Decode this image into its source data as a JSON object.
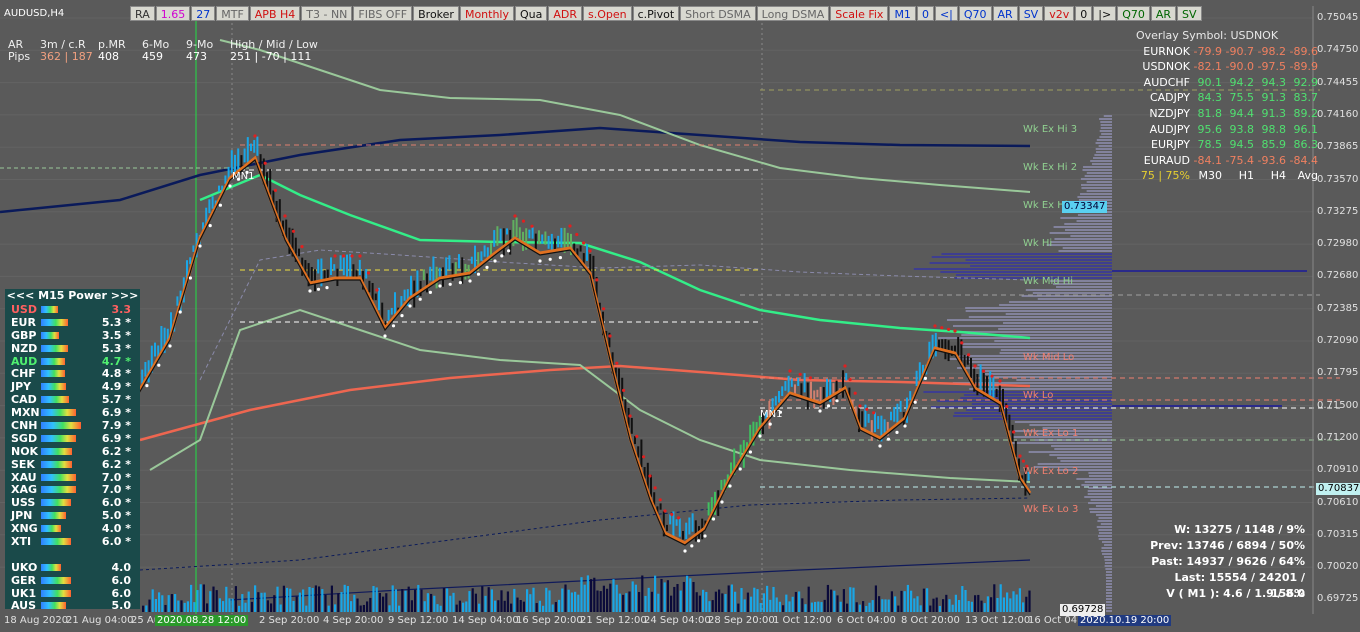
{
  "window": {
    "symbol_label": "AUDUSD,H4"
  },
  "toolbar": [
    {
      "label": "RA",
      "color": "#333"
    },
    {
      "label": "1.65",
      "color": "#d000d0"
    },
    {
      "label": "27",
      "color": "#0033cc"
    },
    {
      "label": "MTF",
      "color": "#666"
    },
    {
      "label": "APB H4",
      "color": "#d01010"
    },
    {
      "label": "T3 - NN",
      "color": "#666"
    },
    {
      "label": "FIBS OFF",
      "color": "#666"
    },
    {
      "label": "Broker",
      "color": "#111"
    },
    {
      "label": "Monthly",
      "color": "#d01010"
    },
    {
      "label": "Qua",
      "color": "#111"
    },
    {
      "label": "ADR",
      "color": "#d01010"
    },
    {
      "label": "s.Open",
      "color": "#d01010"
    },
    {
      "label": "c.Pivot",
      "color": "#111"
    },
    {
      "label": "Short DSMA",
      "color": "#666"
    },
    {
      "label": "Long DSMA",
      "color": "#666"
    },
    {
      "label": "Scale Fix",
      "color": "#d01010"
    },
    {
      "label": "M1",
      "color": "#0033cc"
    },
    {
      "label": "0",
      "color": "#0033cc"
    },
    {
      "label": "<|",
      "color": "#0033cc"
    },
    {
      "label": "Q70",
      "color": "#0033cc"
    },
    {
      "label": "AR",
      "color": "#0033cc"
    },
    {
      "label": "SV",
      "color": "#0033cc"
    },
    {
      "label": "v2v",
      "color": "#d01010"
    },
    {
      "label": "0",
      "color": "#111"
    },
    {
      "label": "|>",
      "color": "#111"
    },
    {
      "label": "Q70",
      "color": "#006600"
    },
    {
      "label": "AR",
      "color": "#006600"
    },
    {
      "label": "SV",
      "color": "#006600"
    }
  ],
  "stats": {
    "headers": [
      "AR",
      "3m / c.R",
      "p.MR",
      "6-Mo",
      "9-Mo",
      "High / Mid / Low"
    ],
    "row_label": "Pips",
    "values": [
      "362 | 187",
      "408",
      "459",
      "473",
      "251  | -70  | 111"
    ]
  },
  "overlay": {
    "title": "Overlay Symbol: USDNOK",
    "rows": [
      {
        "pair": "EURNOK",
        "vals": [
          "-79.9",
          "-90.7",
          "-98.2",
          "-89.6"
        ],
        "color": "#f08060"
      },
      {
        "pair": "USDNOK",
        "vals": [
          "-82.1",
          "-90.0",
          "-97.5",
          "-89.9"
        ],
        "color": "#f08060"
      },
      {
        "pair": "AUDCHF",
        "vals": [
          "90.1",
          "94.2",
          "94.3",
          "92.9"
        ],
        "color": "#50e070"
      },
      {
        "pair": "CADJPY",
        "vals": [
          "84.3",
          "75.5",
          "91.3",
          "83.7"
        ],
        "color": "#50e070"
      },
      {
        "pair": "NZDJPY",
        "vals": [
          "81.8",
          "94.4",
          "91.3",
          "89.2"
        ],
        "color": "#50e070"
      },
      {
        "pair": "AUDJPY",
        "vals": [
          "95.6",
          "93.8",
          "98.8",
          "96.1"
        ],
        "color": "#50e070"
      },
      {
        "pair": "EURJPY",
        "vals": [
          "78.5",
          "94.5",
          "85.9",
          "86.3"
        ],
        "color": "#50e070"
      },
      {
        "pair": "EURAUD",
        "vals": [
          "-84.1",
          "-75.4",
          "-93.6",
          "-84.4"
        ],
        "color": "#f08060"
      }
    ],
    "footer": {
      "pct": "75 | 75%",
      "cols": [
        "M30",
        "H1",
        "H4",
        "Avg"
      ]
    }
  },
  "power": {
    "title": "<<<  M15   Power  >>>",
    "rows": [
      {
        "name": "USD",
        "val": "3.3",
        "level": 0.33,
        "color": "#ff6060"
      },
      {
        "name": "EUR",
        "val": "5.3 *",
        "level": 0.53,
        "color": "#ffffff"
      },
      {
        "name": "GBP",
        "val": "3.5 *",
        "level": 0.35,
        "color": "#ffffff"
      },
      {
        "name": "NZD",
        "val": "5.3 *",
        "level": 0.53,
        "color": "#ffffff"
      },
      {
        "name": "AUD",
        "val": "4.7 *",
        "level": 0.47,
        "color": "#50f070"
      },
      {
        "name": "CHF",
        "val": "4.8 *",
        "level": 0.48,
        "color": "#ffffff"
      },
      {
        "name": "JPY",
        "val": "4.9 *",
        "level": 0.49,
        "color": "#ffffff"
      },
      {
        "name": "CAD",
        "val": "5.7 *",
        "level": 0.57,
        "color": "#ffffff"
      },
      {
        "name": "MXN",
        "val": "6.9 *",
        "level": 0.69,
        "color": "#ffffff"
      },
      {
        "name": "CNH",
        "val": "7.9 *",
        "level": 0.79,
        "color": "#ffffff"
      },
      {
        "name": "SGD",
        "val": "6.9 *",
        "level": 0.69,
        "color": "#ffffff"
      },
      {
        "name": "NOK",
        "val": "6.2 *",
        "level": 0.62,
        "color": "#ffffff"
      },
      {
        "name": "SEK",
        "val": "6.2 *",
        "level": 0.62,
        "color": "#ffffff"
      },
      {
        "name": "XAU",
        "val": "7.0 *",
        "level": 0.7,
        "color": "#ffffff"
      },
      {
        "name": "XAG",
        "val": "7.0 *",
        "level": 0.7,
        "color": "#ffffff"
      },
      {
        "name": "USS",
        "val": "6.0 *",
        "level": 0.6,
        "color": "#ffffff"
      },
      {
        "name": "JPN",
        "val": "5.0 *",
        "level": 0.5,
        "color": "#ffffff"
      },
      {
        "name": "XNG",
        "val": "4.0 *",
        "level": 0.4,
        "color": "#ffffff"
      },
      {
        "name": "XTI",
        "val": "6.0 *",
        "level": 0.6,
        "color": "#ffffff"
      },
      {
        "name": "",
        "val": "",
        "level": 0,
        "color": "#ffffff"
      },
      {
        "name": "UKO",
        "val": "4.0",
        "level": 0.4,
        "color": "#ffffff"
      },
      {
        "name": "GER",
        "val": "6.0",
        "level": 0.6,
        "color": "#ffffff"
      },
      {
        "name": "UK1",
        "val": "6.0",
        "level": 0.6,
        "color": "#ffffff"
      },
      {
        "name": "AUS",
        "val": "5.0",
        "level": 0.5,
        "color": "#ffffff"
      }
    ]
  },
  "price_axis": [
    "0.75045",
    "0.74750",
    "0.74455",
    "0.74160",
    "0.73865",
    "0.73570",
    "0.73275",
    "0.72980",
    "0.72680",
    "0.72385",
    "0.72090",
    "0.71795",
    "0.71500",
    "0.71200",
    "0.70910",
    "0.70610",
    "0.70315",
    "0.70020",
    "0.69725"
  ],
  "time_axis": [
    "18 Aug 2020",
    "21 Aug 04:00",
    "25 Au",
    "2020.08.28 12:00",
    "2 Sep 20:00",
    "4 Sep 20:00",
    "9 Sep 12:00",
    "14 Sep 04:00",
    "16 Sep 20:00",
    "21 Sep 12:00",
    "24 Sep 04:00",
    "28 Sep 20:00",
    "1 Oct 12:00",
    "6 Oct 04:00",
    "8 Oct 20:00",
    "13 Oct 12:00",
    "16 Oct 04:00",
    "2020.10.19 20:00"
  ],
  "levels": [
    {
      "label": "Wk Ex Hi 3",
      "color": "#90d090"
    },
    {
      "label": "Wk Ex Hi 2",
      "color": "#90d090"
    },
    {
      "label": "Wk Ex Hi 1",
      "color": "#90d090"
    },
    {
      "label": "Wk Hi",
      "color": "#90d090"
    },
    {
      "label": "Wk Mid Hi",
      "color": "#90d090"
    },
    {
      "label": "Wk Mid Lo",
      "color": "#f08070"
    },
    {
      "label": "Wk Lo",
      "color": "#f08070"
    },
    {
      "label": "Wk Ex Lo 1",
      "color": "#f08070"
    },
    {
      "label": "Wk Ex Lo 2",
      "color": "#f08070"
    },
    {
      "label": "Wk Ex Lo 3",
      "color": "#f08070"
    }
  ],
  "price_tags": {
    "current": "0.70837",
    "ask_box": "0.73347",
    "low_box": "0.69728"
  },
  "markers": {
    "mn1_a": "MN1",
    "mn1_b": "MN1"
  },
  "summary": [
    "W: 13275 / 1148 / 9%",
    "Prev: 13746 / 6894 / 50%",
    "Past: 14937 / 9626 / 64%",
    "Last: 15554 / 24201 / 156%",
    "V ( M1 ): 4.6 / 1.9 / 8.0"
  ],
  "colors": {
    "bg": "#5a5a5a",
    "bull": "#1aa6e6",
    "bear": "#111111",
    "ma_green": "#33ee88",
    "ma_red": "#ee6650",
    "ma_navy": "#0a1a5a"
  }
}
